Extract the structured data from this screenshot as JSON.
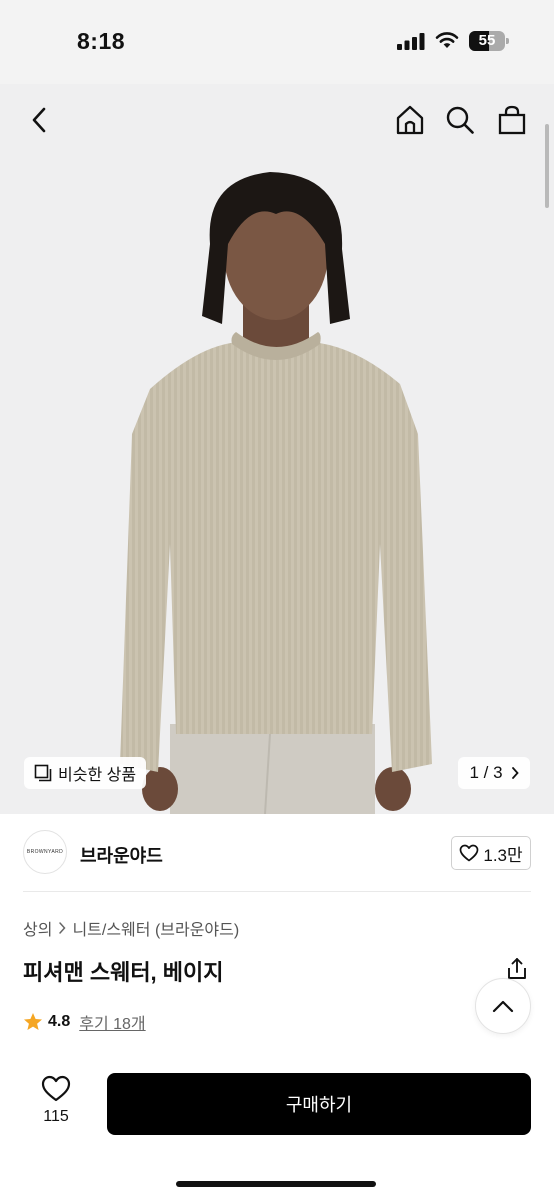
{
  "status_bar": {
    "time": "8:18",
    "battery": "55",
    "battery_level_percent": 55
  },
  "nav": {
    "icons": [
      "back-arrow-icon",
      "home-icon",
      "search-icon",
      "shopping-bag-icon"
    ]
  },
  "gallery": {
    "similar_label": "비슷한 상품",
    "page_indicator": "1 / 3"
  },
  "brand": {
    "logo_text": "BROWNYARD",
    "name": "브라운야드",
    "likes": "1.3만"
  },
  "product": {
    "breadcrumb": [
      "상의",
      "니트/스웨터 (브라운야드)"
    ],
    "title": "피셔맨 스웨터, 베이지",
    "rating": "4.8",
    "reviews": "후기 18개"
  },
  "bottom": {
    "like_count": "115",
    "buy_label": "구매하기"
  },
  "colors": {
    "accent_star": "#f5a623",
    "buy_button": "#000000",
    "sweater": "#c9c1ae",
    "background": "#efeff0"
  }
}
